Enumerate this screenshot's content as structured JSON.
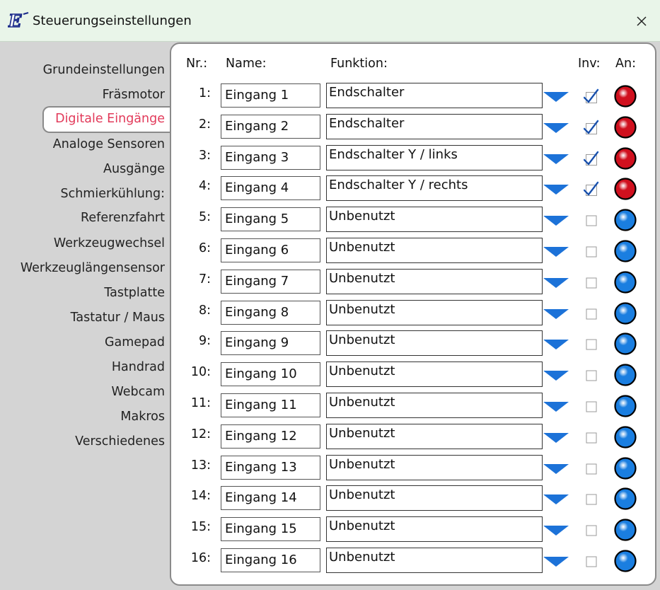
{
  "window": {
    "title": "Steuerungseinstellungen",
    "app_icon": "estlcam-logo-icon",
    "close_icon": "close-icon"
  },
  "sidebar": {
    "items": [
      {
        "label": "Grundeinstellungen"
      },
      {
        "label": "Fräsmotor"
      },
      {
        "label": "Digitale Eingänge",
        "active": true
      },
      {
        "label": "Analoge Sensoren"
      },
      {
        "label": "Ausgänge"
      },
      {
        "label": "Schmierkühlung:"
      },
      {
        "label": "Referenzfahrt"
      },
      {
        "label": "Werkzeugwechsel"
      },
      {
        "label": "Werkzeuglängensensor"
      },
      {
        "label": "Tastplatte"
      },
      {
        "label": "Tastatur / Maus"
      },
      {
        "label": "Gamepad"
      },
      {
        "label": "Handrad"
      },
      {
        "label": "Webcam"
      },
      {
        "label": "Makros"
      },
      {
        "label": "Verschiedenes"
      }
    ]
  },
  "table": {
    "headers": {
      "nr": "Nr.:",
      "name": "Name:",
      "function": "Funktion:",
      "inv": "Inv:",
      "on": "An:"
    },
    "rows": [
      {
        "nr": "1:",
        "name": "Eingang 1",
        "function": "Endschalter",
        "inv": true,
        "on": "red"
      },
      {
        "nr": "2:",
        "name": "Eingang 2",
        "function": "Endschalter",
        "inv": true,
        "on": "red"
      },
      {
        "nr": "3:",
        "name": "Eingang 3",
        "function": "Endschalter Y / links",
        "inv": true,
        "on": "red"
      },
      {
        "nr": "4:",
        "name": "Eingang 4",
        "function": "Endschalter Y / rechts",
        "inv": true,
        "on": "red"
      },
      {
        "nr": "5:",
        "name": "Eingang 5",
        "function": "Unbenutzt",
        "inv": false,
        "on": "blue"
      },
      {
        "nr": "6:",
        "name": "Eingang 6",
        "function": "Unbenutzt",
        "inv": false,
        "on": "blue"
      },
      {
        "nr": "7:",
        "name": "Eingang 7",
        "function": "Unbenutzt",
        "inv": false,
        "on": "blue"
      },
      {
        "nr": "8:",
        "name": "Eingang 8",
        "function": "Unbenutzt",
        "inv": false,
        "on": "blue"
      },
      {
        "nr": "9:",
        "name": "Eingang 9",
        "function": "Unbenutzt",
        "inv": false,
        "on": "blue"
      },
      {
        "nr": "10:",
        "name": "Eingang 10",
        "function": "Unbenutzt",
        "inv": false,
        "on": "blue"
      },
      {
        "nr": "11:",
        "name": "Eingang 11",
        "function": "Unbenutzt",
        "inv": false,
        "on": "blue"
      },
      {
        "nr": "12:",
        "name": "Eingang 12",
        "function": "Unbenutzt",
        "inv": false,
        "on": "blue"
      },
      {
        "nr": "13:",
        "name": "Eingang 13",
        "function": "Unbenutzt",
        "inv": false,
        "on": "blue"
      },
      {
        "nr": "14:",
        "name": "Eingang 14",
        "function": "Unbenutzt",
        "inv": false,
        "on": "blue"
      },
      {
        "nr": "15:",
        "name": "Eingang 15",
        "function": "Unbenutzt",
        "inv": false,
        "on": "blue"
      },
      {
        "nr": "16:",
        "name": "Eingang 16",
        "function": "Unbenutzt",
        "inv": false,
        "on": "blue"
      }
    ]
  },
  "colors": {
    "titlebar_bg": "#e9f5e9",
    "active_nav": "#e23a5a",
    "led_red": "#d0101e",
    "led_blue": "#1a7ee0",
    "dropdown_arrow": "#1c72d8",
    "check_blue": "#2f6fd0"
  }
}
